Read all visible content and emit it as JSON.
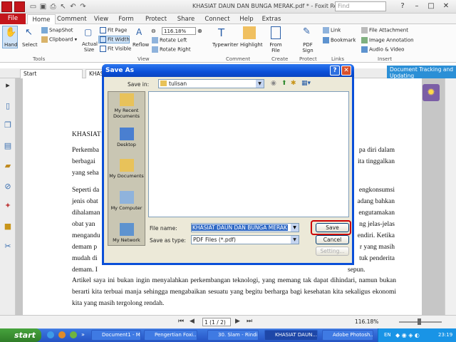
{
  "window": {
    "title": "KHASIAT DAUN DAN BUNGA MERAK.pdf * - Foxit Reader",
    "search_placeholder": "Find"
  },
  "menu": {
    "tabs": [
      "File",
      "Home",
      "Comment",
      "View",
      "Form",
      "Protect",
      "Share",
      "Connect",
      "Help",
      "Extras"
    ]
  },
  "ribbon": {
    "hand": "Hand",
    "select": "Select",
    "snapshot": "SnapShot",
    "clipboard": "Clipboard",
    "actual_size": "Actual Size",
    "fit_page": "Fit Page",
    "fit_width": "Fit Width",
    "fit_visible": "Fit Visible",
    "reflow": "Reflow",
    "zoom": "116.18%",
    "rotate_left": "Rotate Left",
    "rotate_right": "Rotate Right",
    "typewriter": "Typewriter",
    "highlight": "Highlight",
    "from_file": "From File",
    "pdf_sign": "PDF Sign",
    "link": "Link",
    "bookmark": "Bookmark",
    "file_attachment": "File Attachment",
    "image_annotation": "Image Annotation",
    "audio_video": "Audio & Video",
    "groups": {
      "tools": "Tools",
      "view": "View",
      "comment": "Comment",
      "create": "Create",
      "protect": "Protect",
      "links": "Links",
      "insert": "Insert"
    }
  },
  "promo": "Document Tracking and Updating",
  "tabs": {
    "start": "Start",
    "doc": "KHAS"
  },
  "document": {
    "heading": "KHASIAT D",
    "p1_left": [
      "Perkemba",
      "berbagai",
      "yang seha"
    ],
    "p1_right": [
      "pa diri dalam",
      "ita tinggalkan"
    ],
    "p2_left": [
      "Seperti da",
      "jenis obat",
      "dihalaman",
      "obat yan",
      "mengandu",
      "demam p",
      "mudah di",
      "demam. I"
    ],
    "p2_right": [
      "engkonsumsi",
      "adang bahkan",
      "engutamakan",
      "ng jelas-jelas",
      "endiri. Ketika",
      "r yang masih",
      "tuk penderita",
      "sepun."
    ],
    "p3": "Artikel saya ini bukan ingin menyalahkan perkembangan teknologi, yang memang tak dapat dihindari, namun bukan berarti kita terbuai manja sehingga mengabaikan sesuatu yang begitu berharga bagi kesehatan kita sekaligus ekonomi kita yang masih tergolong rendah."
  },
  "status": {
    "page": "1 (1 / 2)",
    "zoom": "116.18%"
  },
  "dialog": {
    "title": "Save As",
    "save_in_label": "Save in:",
    "save_in_value": "tulisan",
    "places": [
      "My Recent Documents",
      "Desktop",
      "My Documents",
      "My Computer",
      "My Network"
    ],
    "file_name_label": "File name:",
    "file_name_value": "KHASIAT DAUN DAN BUNGA MERAK",
    "save_type_label": "Save as type:",
    "save_type_value": "PDF Files (*.pdf)",
    "save_btn": "Save",
    "cancel_btn": "Cancel",
    "settings_btn": "Setting..."
  },
  "taskbar": {
    "start": "start",
    "items": [
      "Document1 - Mi...",
      "Pengertian Foxi...",
      "30. Slam - Rindi...",
      "KHASIAT DAUN...",
      "Adobe Photosh..."
    ],
    "lang": "EN",
    "time": "23:19"
  }
}
